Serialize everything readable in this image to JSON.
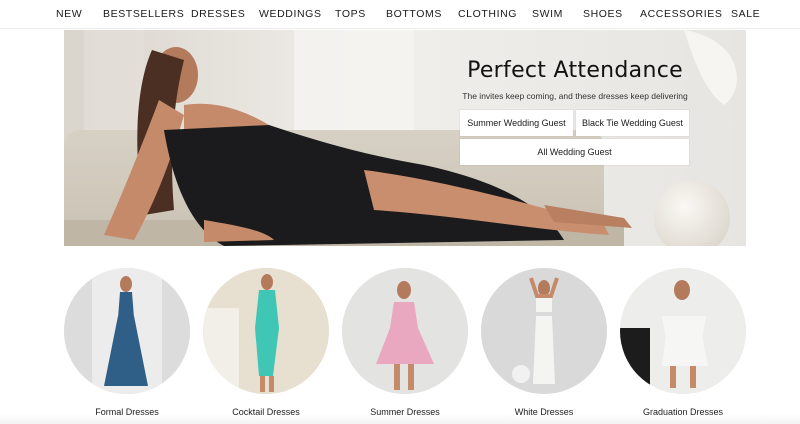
{
  "nav": {
    "items": [
      "NEW",
      "BESTSELLERS",
      "DRESSES",
      "WEDDINGS",
      "TOPS",
      "BOTTOMS",
      "CLOTHING",
      "SWIM",
      "SHOES",
      "ACCESSORIES",
      "SALE"
    ]
  },
  "hero": {
    "title": "Perfect Attendance",
    "subtitle": "The invites keep coming, and these dresses keep delivering",
    "buttons": [
      "Summer Wedding Guest",
      "Black Tie Wedding Guest",
      "All Wedding Guest"
    ],
    "image": "woman-in-black-strapless-dress-reclining"
  },
  "categories": [
    {
      "label": "Formal Dresses",
      "dress_color": "#2f5f86"
    },
    {
      "label": "Cocktail Dresses",
      "dress_color": "#3fc6b5"
    },
    {
      "label": "Summer Dresses",
      "dress_color": "#e9a8c0"
    },
    {
      "label": "White Dresses",
      "dress_color": "#f4f4f2"
    },
    {
      "label": "Graduation Dresses",
      "dress_color": "#f6f6f4"
    }
  ],
  "colors": {
    "text": "#1a1a1a",
    "button_bg": "#ffffff",
    "hero_dress": "#1b1b1d"
  }
}
